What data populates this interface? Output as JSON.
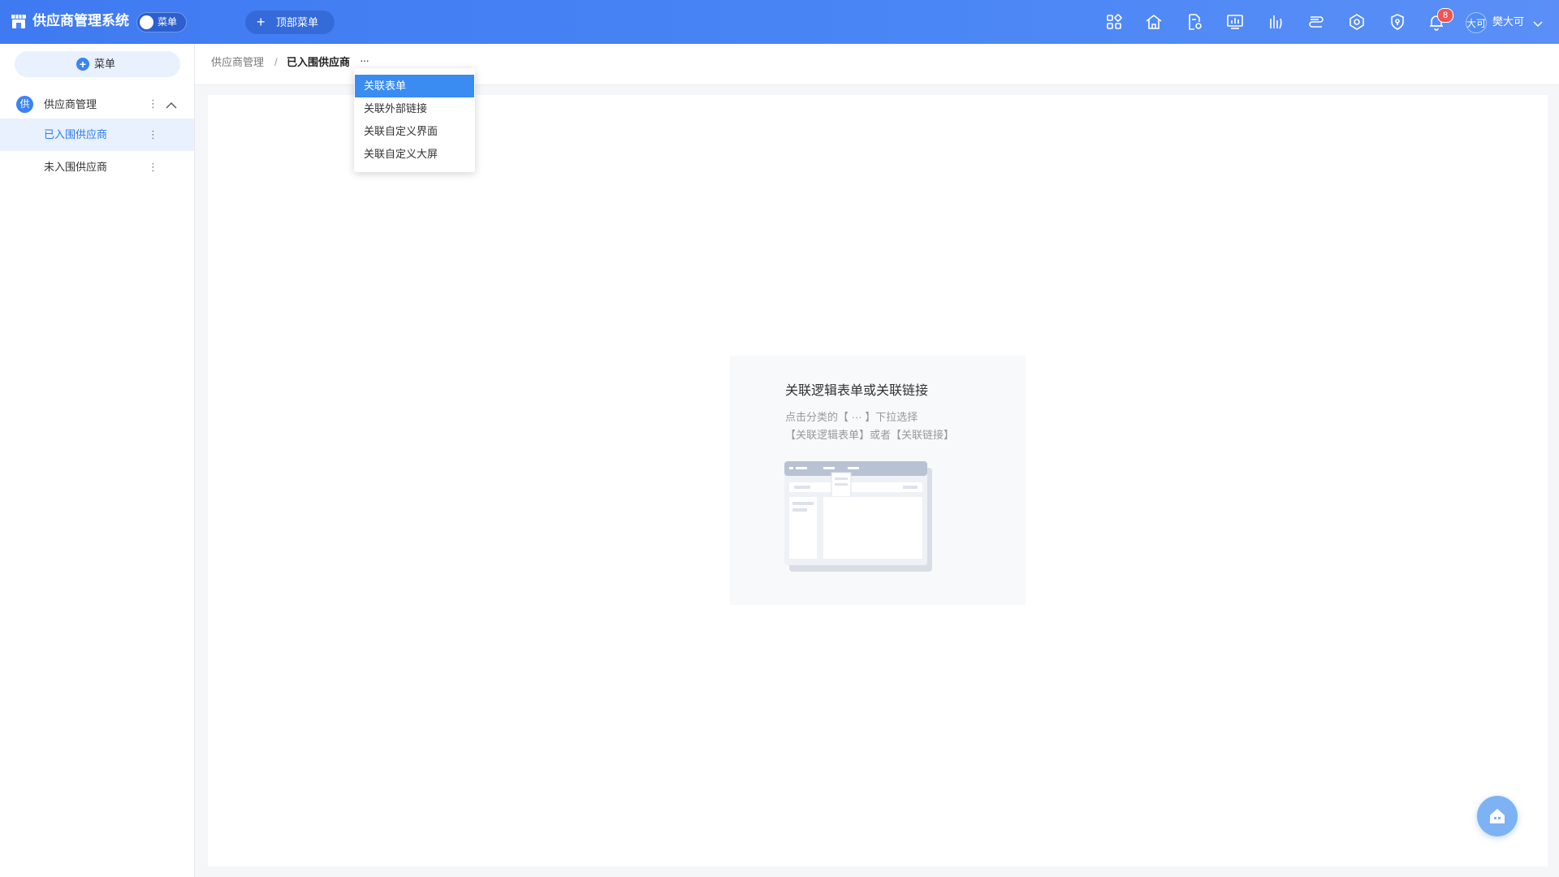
{
  "header": {
    "app_title": "供应商管理系统",
    "toggle_label": "菜单",
    "top_menu_label": "顶部菜单",
    "notification_count": "8",
    "avatar_text": "大可",
    "username": "樊大可",
    "icons": [
      "apps-icon",
      "home-icon",
      "document-settings-icon",
      "dashboard-icon",
      "chart-icon",
      "flow-icon",
      "cube-icon",
      "shield-icon",
      "bell-icon"
    ]
  },
  "sidebar": {
    "add_menu_label": "菜单",
    "group": {
      "badge": "供",
      "label": "供应商管理"
    },
    "items": [
      {
        "label": "已入围供应商",
        "active": true
      },
      {
        "label": "未入围供应商",
        "active": false
      }
    ]
  },
  "breadcrumb": {
    "parent": "供应商管理",
    "separator": "/",
    "current": "已入围供应商",
    "more": "···"
  },
  "dropdown": {
    "items": [
      "关联表单",
      "关联外部链接",
      "关联自定义界面",
      "关联自定义大屏"
    ],
    "highlighted_index": 0
  },
  "empty_state": {
    "title": "关联逻辑表单或关联链接",
    "hint_line1": "点击分类的【 ··· 】下拉选择",
    "hint_line2": "【关联逻辑表单】或者【关联链接】"
  },
  "colors": {
    "primary": "#3a83f4",
    "header_gradient_start": "#3f7af2",
    "header_gradient_end": "#5b8ff7",
    "active_bg": "#e8f1fd",
    "badge_red": "#f05454"
  }
}
